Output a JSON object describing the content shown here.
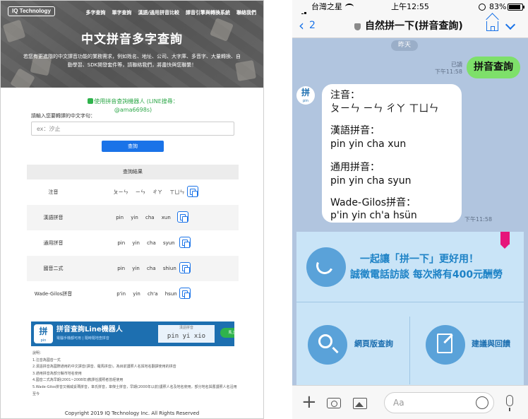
{
  "website": {
    "logo": "IQ Technology",
    "nav": [
      "多字查詢",
      "單字查詢",
      "漢語/通用拼音比較",
      "譯音引擎與轉換系統",
      "聯絡我們"
    ],
    "hero_title": "中文拼音多字查詢",
    "hero_desc": "若您有更進階的中文譯音功能的業務需求，例如姓名、地址、公司、大字庫、多音字、大量轉換、自動學習、SDK開發套件等，請聯絡我們，將盡快與您聯繫！",
    "line_bot_text": "使用拼音查詢機器人 (LINE搜尋：@ama6698s)",
    "input_label": "請輸入您要轉譯的中文字句：",
    "input_placeholder": "ex：汐止",
    "query_button": "查詢",
    "result_header": "查詢結果",
    "results": [
      {
        "label": "注音",
        "value": "ㄆㄧㄣ ㄧㄣ ㄔㄚ ㄒㄩㄣ"
      },
      {
        "label": "漢語拼音",
        "value": "pin yin cha xun"
      },
      {
        "label": "通用拼音",
        "value": "pin yin cha syun"
      },
      {
        "label": "國音二式",
        "value": "pin yin cha shiun"
      },
      {
        "label": "Wade-Gilos拼音",
        "value": "p'in yin ch'a hsun"
      }
    ],
    "banner": {
      "icon": "拼",
      "icon_sub": "pin",
      "title": "拼音查詢Line機器人",
      "subtitle": "電腦手機都可用 | 隨時隨地查拼音",
      "demo_top": "漢語拼音",
      "demo_value": "pin yi xio",
      "add_friend": "馬上加好友"
    },
    "notes_title": "說明：",
    "notes": [
      "1.注音為國音一式",
      "2.漢語拼音為國際通用的中文譯音(譯音、羅馬拼音)，為目前護照人名與地名翻譯使用的拼音",
      "3.通用拼音為部分縣市地名使用",
      "4.國音二式為早期(2001~2008年)教譯任護照者曾經使用",
      "5.Wade-Gilos拼音又稱威妥瑪拼音，韋氏拼音，韋傑士拼音，早期(2000年以前)護照人名及地名使用，部分地名與舊護照人名沿用至今"
    ],
    "copyright": "Copyright 2019 IQ Technology Inc. All Rights Reserved"
  },
  "phone": {
    "status": {
      "carrier": "台灣之星",
      "time": "上午12:55",
      "battery": "83%"
    },
    "header": {
      "back_count": "2",
      "title": "自然拼一下(拼音查詢)"
    },
    "date_divider": "昨天",
    "sent": {
      "text": "拼音查詢",
      "read": "已讀",
      "time": "下午11:58"
    },
    "bot_avatar": "拼",
    "bot_avatar_sub": "pin",
    "reply": {
      "zhuyin_label": "注音：",
      "zhuyin_value": "ㄆㄧㄣ ㄧㄣ ㄔㄚ ㄒㄩㄣ",
      "hanyu_label": "漢語拼音：",
      "hanyu_value": "pin yin cha xun",
      "tongyong_label": "通用拼音：",
      "tongyong_value": "pin yin cha syun",
      "wade_label": "Wade-Gilos拼音：",
      "wade_value": "p'in yin ch'a hsün",
      "time": "下午11:58"
    },
    "rich_menu": {
      "promo_line1": "一起讓「拼一下」更好用！",
      "promo_line2": "誠徵電話訪談 每次將有400元酬勞",
      "web_query": "網頁版查詢",
      "feedback": "建議與回饋"
    },
    "input_placeholder": "Aa"
  },
  "colors": {
    "accent": "#1a73e8",
    "line_green": "#7ee06a",
    "chat_bg": "#b1c5df",
    "menu_bg": "#c9e4f7",
    "brand_blue": "#1d6fb0"
  }
}
